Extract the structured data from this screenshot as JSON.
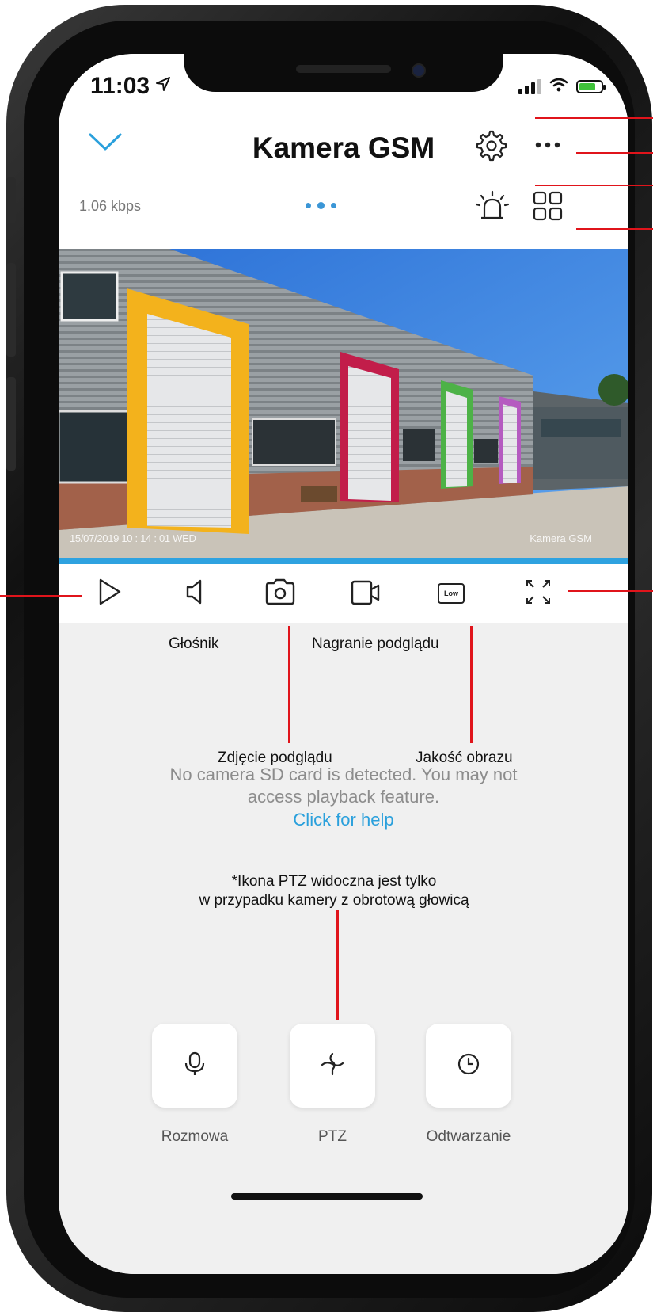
{
  "status": {
    "time": "11:03"
  },
  "header": {
    "title": "Kamera GSM"
  },
  "stream": {
    "bitrate": "1.06 kbps"
  },
  "video": {
    "timestamp": "15/07/2019 10 : 14 : 01 WED",
    "camera_label": "Kamera GSM",
    "progress": 1.0
  },
  "controls": {
    "quality_badge": "Low"
  },
  "message": {
    "sd_line1": "No camera SD card is detected. You may not",
    "sd_line2": "access playback feature.",
    "help": "Click for help"
  },
  "bottom_buttons": [
    {
      "label": "Rozmowa",
      "icon": "microphone-icon"
    },
    {
      "label": "PTZ",
      "icon": "ptz-icon"
    },
    {
      "label": "Odtwarzanie",
      "icon": "clock-icon"
    }
  ],
  "annotations": {
    "speaker": "Głośnik",
    "record": "Nagranie podglądu",
    "snapshot": "Zdjęcie podglądu",
    "quality": "Jakość obrazu",
    "ptz_note_line1": "*Ikona PTZ widoczna jest tylko",
    "ptz_note_line2": "w przypadku kamery z obrotową głowicą"
  },
  "colors": {
    "accent": "#2aa0dc",
    "annotation_line": "#e0141b",
    "battery": "#3fc23a"
  }
}
